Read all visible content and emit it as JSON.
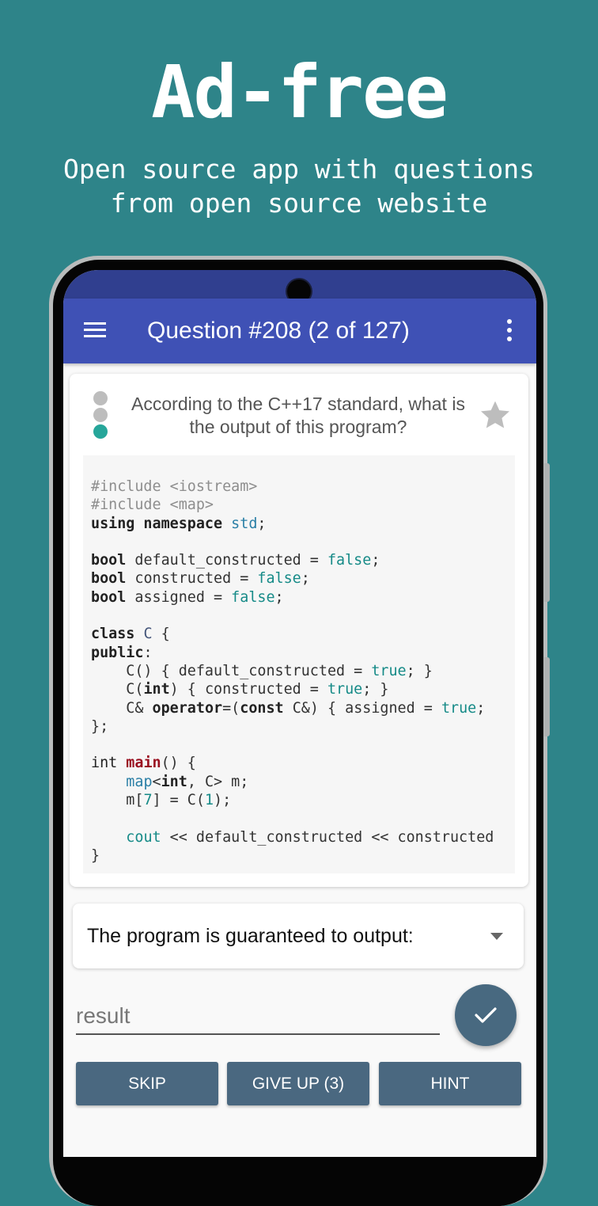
{
  "promo": {
    "title": "Ad-free",
    "subtitle_line1": "Open source app with questions",
    "subtitle_line2": "from open source website"
  },
  "colors": {
    "background": "#2e8489",
    "toolbar": "#3f51b5",
    "status_bar": "#303f8f",
    "button": "#4a6880",
    "dot_inactive": "#bdbdbd",
    "dot_active": "#26a69a",
    "star": "#bdbdbd"
  },
  "toolbar": {
    "menu_icon": "hamburger-menu-icon",
    "title": "Question #208 (2 of 127)",
    "more_icon": "more-vert-icon"
  },
  "question": {
    "progress_dots": [
      "inactive",
      "inactive",
      "active"
    ],
    "text": "According to the C++17 standard, what is the output of this program?",
    "favorite_icon": "star-icon",
    "code_lines": [
      "#include <iostream>",
      "#include <map>",
      "using namespace std;",
      "",
      "bool default_constructed = false;",
      "bool constructed = false;",
      "bool assigned = false;",
      "",
      "class C {",
      "public:",
      "    C() { default_constructed = true; }",
      "    C(int) { constructed = true; }",
      "    C& operator=(const C&) { assigned = true;",
      "};",
      "",
      "int main() {",
      "    map<int, C> m;",
      "    m[7] = C(1);",
      "",
      "    cout << default_constructed << constructed",
      "}"
    ]
  },
  "answer": {
    "dropdown_selected": "The program is guaranteed to output:",
    "input_placeholder": "result",
    "input_value": "",
    "submit_icon": "check-icon"
  },
  "buttons": {
    "skip": "SKIP",
    "give_up": "GIVE UP (3)",
    "hint": "HINT"
  }
}
